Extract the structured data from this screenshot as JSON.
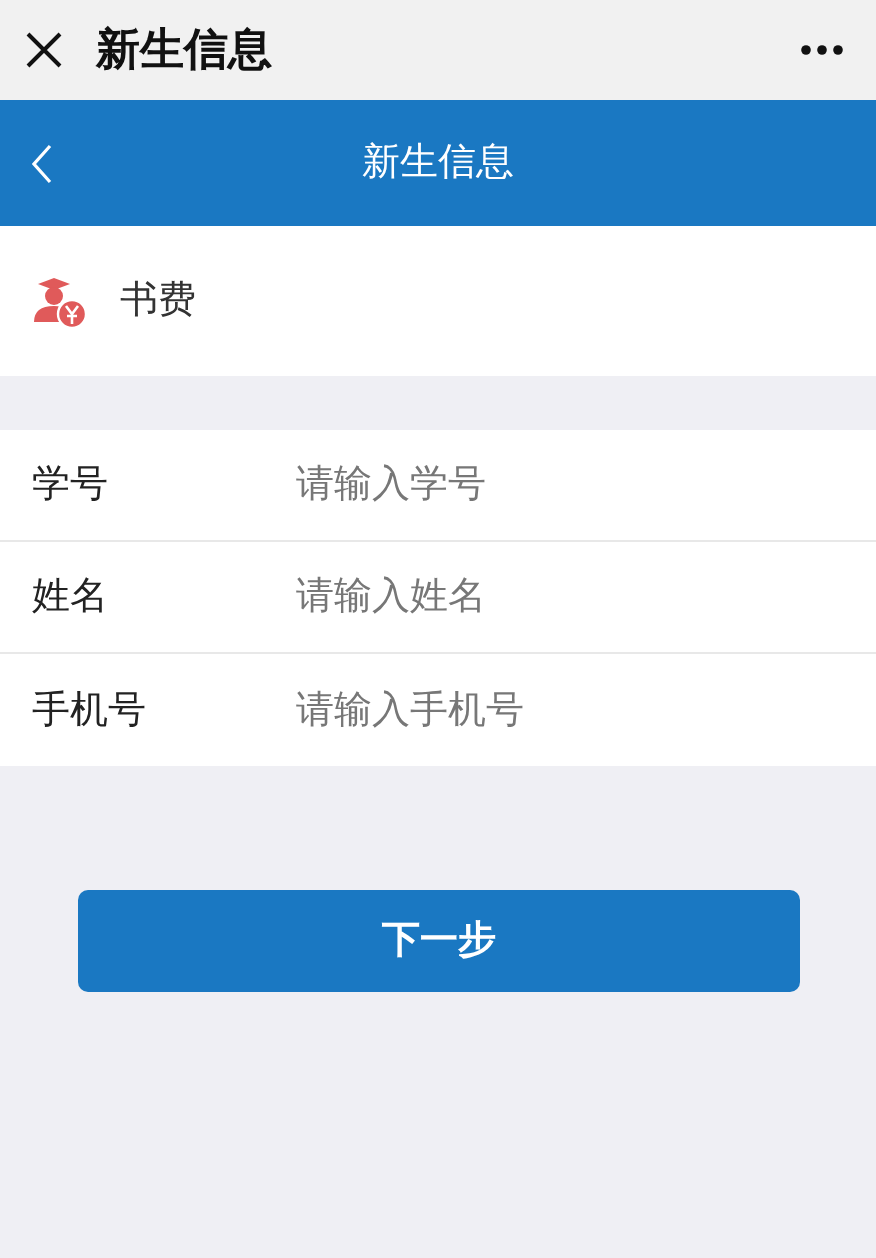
{
  "window": {
    "title": "新生信息"
  },
  "header": {
    "title": "新生信息"
  },
  "fee": {
    "label": "书费"
  },
  "fields": [
    {
      "label": "学号",
      "placeholder": "请输入学号"
    },
    {
      "label": "姓名",
      "placeholder": "请输入姓名"
    },
    {
      "label": "手机号",
      "placeholder": "请输入手机号"
    }
  ],
  "buttons": [
    "下一步"
  ]
}
